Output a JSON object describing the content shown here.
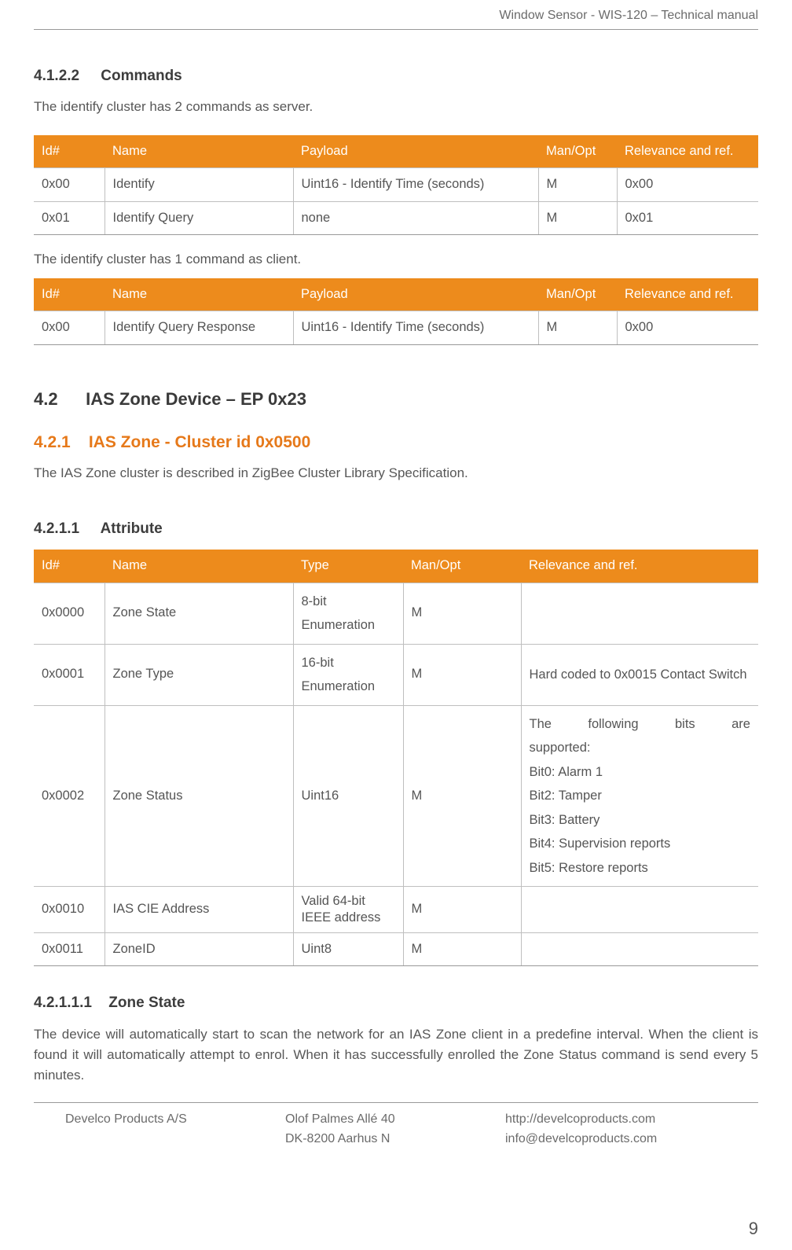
{
  "header": {
    "running_title": "Window Sensor - WIS-120 – Technical manual"
  },
  "s4122": {
    "num": "4.1.2.2",
    "title": "Commands",
    "intro_server": "The identify cluster has 2 commands as server.",
    "intro_client": "The identify cluster has 1 command as client."
  },
  "cmd_table_headers": {
    "id": "Id#",
    "name": "Name",
    "payload": "Payload",
    "manopt": "Man/Opt",
    "rel": "Relevance and ref."
  },
  "server_cmds": [
    {
      "id": "0x00",
      "name": "Identify",
      "payload": "Uint16 - Identify Time (seconds)",
      "manopt": "M",
      "rel": "0x00"
    },
    {
      "id": "0x01",
      "name": "Identify Query",
      "payload": "none",
      "manopt": "M",
      "rel": "0x01"
    }
  ],
  "client_cmds": [
    {
      "id": "0x00",
      "name": "Identify Query Response",
      "payload": "Uint16 - Identify Time (seconds)",
      "manopt": "M",
      "rel": "0x00"
    }
  ],
  "s42": {
    "num": "4.2",
    "title": "IAS Zone Device – EP 0x23"
  },
  "s421": {
    "num": "4.2.1",
    "title": "IAS Zone - Cluster id 0x0500",
    "intro": "The IAS Zone cluster is described in ZigBee Cluster Library Specification."
  },
  "s4211": {
    "num": "4.2.1.1",
    "title": "Attribute"
  },
  "attr_table_headers": {
    "id": "Id#",
    "name": "Name",
    "type": "Type",
    "manopt": "Man/Opt",
    "rel": "Relevance and ref."
  },
  "attrs": [
    {
      "id": "0x0000",
      "name": "Zone State",
      "type": "8-bit Enumeration",
      "manopt": "M",
      "rel": ""
    },
    {
      "id": "0x0001",
      "name": "Zone Type",
      "type": "16-bit Enumeration",
      "manopt": "M",
      "rel": "Hard coded to 0x0015 Contact Switch"
    },
    {
      "id": "0x0002",
      "name": "Zone Status",
      "type": "Uint16",
      "manopt": "M",
      "rel_lines": {
        "l0a": "The",
        "l0b": "following",
        "l0c": "bits",
        "l0d": "are",
        "l1": "supported:",
        "l2": "Bit0: Alarm 1",
        "l3": "Bit2: Tamper",
        "l4": "Bit3: Battery",
        "l5": "Bit4: Supervision reports",
        "l6": "Bit5: Restore reports"
      }
    },
    {
      "id": "0x0010",
      "name": "IAS CIE Address",
      "type": "Valid 64-bit IEEE address",
      "manopt": "M",
      "rel": ""
    },
    {
      "id": "0x0011",
      "name": "ZoneID",
      "type": "Uint8",
      "manopt": "M",
      "rel": ""
    }
  ],
  "s42111": {
    "num": "4.2.1.1.1",
    "title": "Zone State",
    "para": "The device will automatically start to scan the network for an IAS Zone client in a predefine interval. When the client is found it will automatically attempt to enrol. When it has successfully enrolled the Zone Status command is send every 5 minutes."
  },
  "footer": {
    "company": "Develco Products A/S",
    "addr1": "Olof Palmes Allé 40",
    "addr2": "DK-8200 Aarhus N",
    "url": "http://develcoproducts.com",
    "email": "info@develcoproducts.com",
    "page": "9"
  }
}
